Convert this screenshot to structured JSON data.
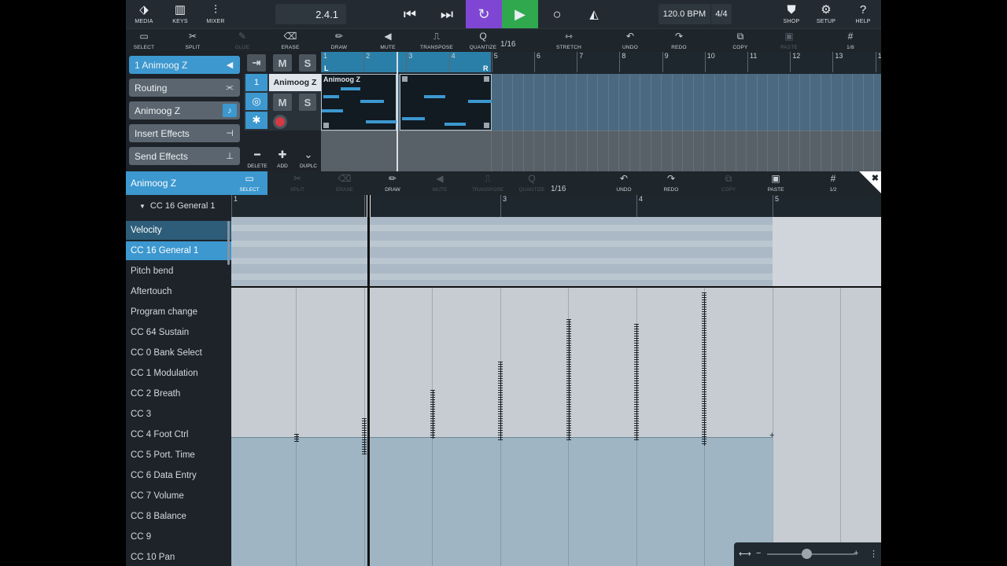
{
  "topbar": {
    "media": "MEDIA",
    "keys": "KEYS",
    "mixer": "MIXER",
    "position": "2.4.1",
    "tempo": "120.0 BPM",
    "signature": "4/4",
    "shop": "SHOP",
    "setup": "SETUP",
    "help": "HELP"
  },
  "toolbar1": {
    "select": "SELECT",
    "split": "SPLIT",
    "glue": "GLUE",
    "erase": "ERASE",
    "draw": "DRAW",
    "mute": "MUTE",
    "transpose": "TRANSPOSE",
    "quantize": "QUANTIZE",
    "quant_value": "1/16",
    "stretch": "STRETCH",
    "undo": "UNDO",
    "redo": "REDO",
    "copy": "COPY",
    "paste": "PASTE",
    "grid": "1/8"
  },
  "inspector": {
    "track": "1  Animoog Z",
    "routing": "Routing",
    "instrument": "Animoog Z",
    "insert": "Insert Effects",
    "send": "Send Effects"
  },
  "track": {
    "m": "M",
    "s": "S",
    "number": "1",
    "name": "Animoog Z",
    "delete": "DELETE",
    "add": "ADD",
    "duplicate": "DUPLC"
  },
  "arrange": {
    "ruler": [
      "1",
      "2",
      "3",
      "4",
      "5",
      "6",
      "7",
      "8",
      "9",
      "10",
      "11",
      "12",
      "13",
      "1"
    ],
    "locator_left": "L",
    "locator_right": "R",
    "part_name": "Animoog Z"
  },
  "editor": {
    "title": "Animoog Z",
    "lane_label": "CC 16 General 1",
    "tools": {
      "select": "SELECT",
      "split": "SPLIT",
      "erase": "ERASE",
      "draw": "DRAW",
      "mute": "MUTE",
      "transpose": "TRANSPOSE",
      "quantize": "QUANTIZE",
      "quant_value": "1/16",
      "undo": "UNDO",
      "redo": "REDO",
      "copy": "COPY",
      "paste": "PASTE",
      "grid": "1/2"
    },
    "ruler": [
      "1",
      "2",
      "3",
      "4",
      "5"
    ],
    "cc_items": [
      "Velocity",
      "CC 16 General 1",
      "Pitch bend",
      "Aftertouch",
      "Program change",
      "CC 64 Sustain",
      "CC 0 Bank Select",
      "CC 1 Modulation",
      "CC 2 Breath",
      "CC 3",
      "CC 4 Foot Ctrl",
      "CC 5 Port. Time",
      "CC 6 Data Entry",
      "CC 7 Volume",
      "CC 8 Balance",
      "CC 9",
      "CC 10 Pan"
    ]
  },
  "colors": {
    "accent": "#3c98cf",
    "cycle": "#7f46d4",
    "play": "#2fa84e",
    "record": "#d33a43"
  }
}
